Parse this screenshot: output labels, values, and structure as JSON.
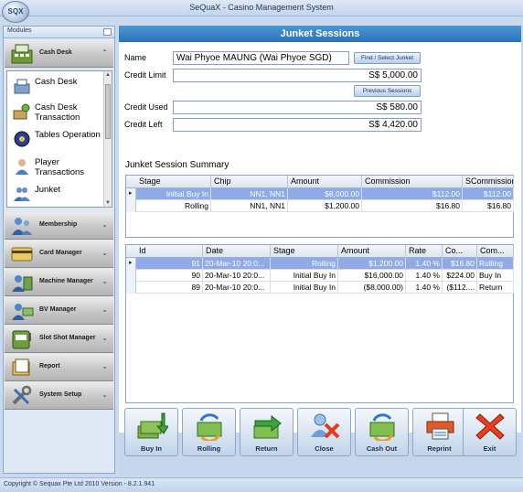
{
  "window": {
    "title": "SeQuaX - Casino Management System",
    "logo_text": "SQX"
  },
  "modules": {
    "header": "Modules",
    "active_group": "Cash Desk",
    "sub_items": [
      {
        "label": "Cash Desk",
        "icon": "cash-register-icon"
      },
      {
        "label": "Cash Desk Transaction",
        "icon": "cash-transaction-icon"
      },
      {
        "label": "Tables Operation",
        "icon": "roulette-table-icon"
      },
      {
        "label": "Player Transactions",
        "icon": "player-icon"
      },
      {
        "label": "Junket",
        "icon": "junket-people-icon"
      }
    ],
    "groups": [
      {
        "label": "Membership",
        "icon": "membership-icon"
      },
      {
        "label": "Card Manager",
        "icon": "card-icon"
      },
      {
        "label": "Machine Manager",
        "icon": "machine-icon"
      },
      {
        "label": "BV Manager",
        "icon": "bill-validator-icon"
      },
      {
        "label": "Slot Shot Manager",
        "icon": "slot-machine-icon"
      },
      {
        "label": "Report",
        "icon": "report-icon"
      },
      {
        "label": "System Setup",
        "icon": "tools-icon"
      }
    ]
  },
  "junket": {
    "title": "Junket Sessions",
    "name_label": "Name",
    "name_value": "Wai Phyoe MAUNG (Wai Phyoe SGD)",
    "find_button": "Find / Select Junket",
    "credit_limit_label": "Credit Limit",
    "credit_limit_value": "S$ 5,000.00",
    "previous_sessions_button": "Previous Sessions",
    "credit_used_label": "Credit Used",
    "credit_used_value": "S$ 580.00",
    "credit_left_label": "Credit Left",
    "credit_left_value": "S$ 4,420.00",
    "summary_title": "Junket Session Summary",
    "summary_columns": [
      "Stage",
      "Chip",
      "Amount",
      "Commission",
      "SCommission"
    ],
    "summary_rows": [
      {
        "stage": "Initial Buy In",
        "chip": "NN1, NN1",
        "amount": "$8,000.00",
        "commission": "$112.00",
        "scommission": "$112.00",
        "selected": true
      },
      {
        "stage": "Rolling",
        "chip": "NN1, NN1",
        "amount": "$1,200.00",
        "commission": "$16.80",
        "scommission": "$16.80",
        "selected": false
      }
    ],
    "detail_columns": [
      "Id",
      "Date",
      "Stage",
      "Amount",
      "Rate",
      "Co...",
      "Com..."
    ],
    "detail_rows": [
      {
        "id": "91",
        "date": "20-Mar-10 20:0...",
        "stage": "Rolling",
        "amount": "$1,200.00",
        "rate": "1.40 %",
        "co": "$16.80",
        "com": "Rolling",
        "selected": true
      },
      {
        "id": "90",
        "date": "20-Mar-10 20:0...",
        "stage": "Initial Buy In",
        "amount": "$16,000.00",
        "rate": "1.40 %",
        "co": "$224.00",
        "com": "Buy In",
        "selected": false
      },
      {
        "id": "89",
        "date": "20-Mar-10 20:0...",
        "stage": "Initial Buy In",
        "amount": "($8,000.00)",
        "rate": "1.40 %",
        "co": "($112....",
        "com": "Return",
        "selected": false
      }
    ]
  },
  "toolbar": {
    "buttons": [
      {
        "label": "Buy In",
        "icon": "buy-in-icon"
      },
      {
        "label": "Rolling",
        "icon": "rolling-icon"
      },
      {
        "label": "Return",
        "icon": "return-icon"
      },
      {
        "label": "Close",
        "icon": "close-session-icon"
      },
      {
        "label": "Cash Out",
        "icon": "cash-out-icon"
      },
      {
        "label": "Reprint",
        "icon": "printer-icon"
      },
      {
        "label": "Exit",
        "icon": "exit-icon"
      }
    ]
  },
  "status": {
    "text": "Copyright © Sequax Pte Ltd 2010   Version - 8.2.1.941"
  }
}
